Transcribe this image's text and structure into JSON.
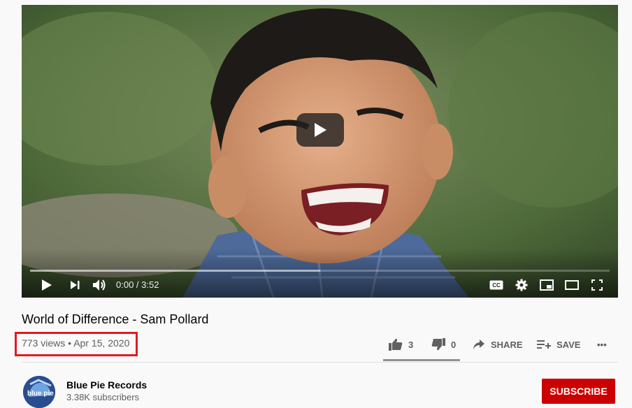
{
  "video": {
    "title": "World of Difference - Sam Pollard",
    "views": "773 views",
    "separator": "•",
    "date": "Apr 15, 2020",
    "time_display": "0:00 / 3:52",
    "buffered_fraction": 0.5
  },
  "actions": {
    "like_count": "3",
    "dislike_count": "0",
    "share_label": "SHARE",
    "save_label": "SAVE",
    "more_label": "•••"
  },
  "channel": {
    "name": "Blue Pie Records",
    "subscribers": "3.38K subscribers",
    "avatar_text": "blue pie",
    "subscribe_label": "SUBSCRIBE"
  },
  "colors": {
    "subscribe_bg": "#cc0000",
    "highlight_box": "#e01b22"
  }
}
